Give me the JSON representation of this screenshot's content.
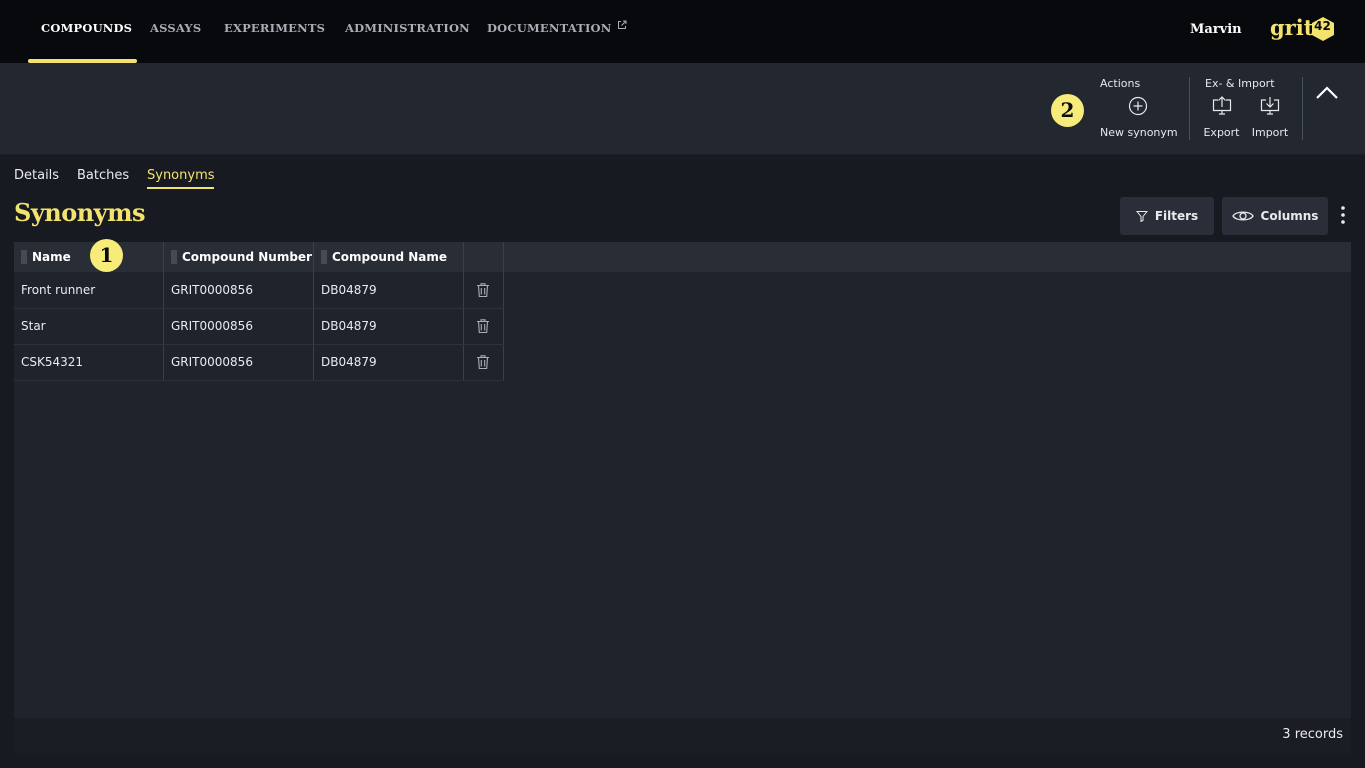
{
  "nav": {
    "items": [
      {
        "label": "COMPOUNDS"
      },
      {
        "label": "ASSAYS"
      },
      {
        "label": "EXPERIMENTS"
      },
      {
        "label": "ADMINISTRATION"
      },
      {
        "label": "DOCUMENTATION"
      }
    ],
    "active": "COMPOUNDS",
    "user": "Marvin",
    "logo_text": "grit",
    "logo_number": "42"
  },
  "toolbar": {
    "marker": "2",
    "actions_title": "Actions",
    "new_synonym_label": "New synonym",
    "eximport_title": "Ex- & Import",
    "export_label": "Export",
    "import_label": "Import"
  },
  "subtabs": [
    {
      "label": "Details"
    },
    {
      "label": "Batches"
    },
    {
      "label": "Synonyms"
    }
  ],
  "active_subtab": "Synonyms",
  "page": {
    "title": "Synonyms",
    "filters_label": "Filters",
    "columns_label": "Columns"
  },
  "grid": {
    "marker": "1",
    "columns": [
      "Name",
      "Compound Number",
      "Compound Name"
    ],
    "rows": [
      {
        "name": "Front runner",
        "compound_number": "GRIT0000856",
        "compound_name": "DB04879"
      },
      {
        "name": "Star",
        "compound_number": "GRIT0000856",
        "compound_name": "DB04879"
      },
      {
        "name": "CSK54321",
        "compound_number": "GRIT0000856",
        "compound_name": "DB04879"
      }
    ],
    "records_label": "3 records"
  },
  "colors": {
    "accent": "#f3e36e",
    "topbar": "#08090c",
    "toolbar": "#232730",
    "background": "#171a21",
    "grid": "#1f232b"
  },
  "icons": [
    "external-link-icon",
    "add-circle-icon",
    "export-icon",
    "import-icon",
    "chevron-up-icon",
    "filter-icon",
    "eye-icon",
    "more-vert-icon",
    "trash-icon"
  ]
}
